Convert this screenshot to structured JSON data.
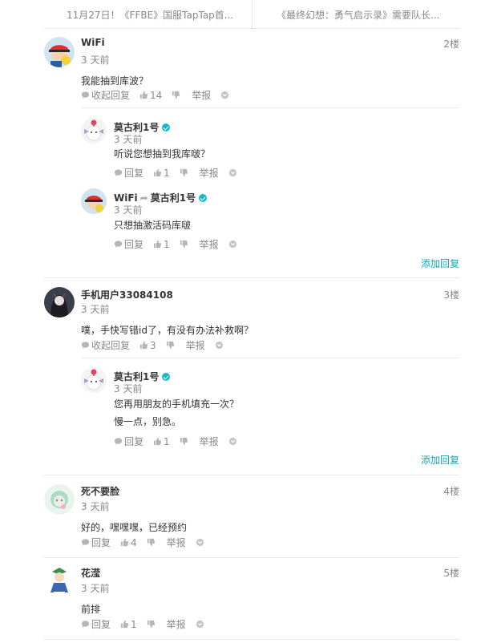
{
  "nav": {
    "prev": "11月27日！《FFBE》国服TapTap首...",
    "next": "《最终幻想：勇气启示录》需要队长..."
  },
  "labels": {
    "collapse_reply": "收起回复",
    "reply": "回复",
    "report": "举报",
    "add_reply": "添加回复"
  },
  "comments": [
    {
      "user": "WiFi",
      "time": "3 天前",
      "floor": "2楼",
      "text": "我能抽到库波？",
      "likes": "14",
      "replies": [
        {
          "user": "莫古利1号",
          "time": "3 天前",
          "text": "听说您想抽到我库啵？",
          "likes": "1"
        },
        {
          "user": "WiFi",
          "to": "莫古利1号",
          "time": "3 天前",
          "text": "只想抽激活码库啵",
          "likes": "1"
        }
      ]
    },
    {
      "user": "手机用户33084108",
      "time": "3 天前",
      "floor": "3楼",
      "text": "噗，手快写错id了，有没有办法补救啊？",
      "likes": "3",
      "replies": [
        {
          "user": "莫古利1号",
          "time": "3 天前",
          "text": "您再用朋友的手机填充一次？",
          "text2": "慢一点，别急。",
          "likes": "1"
        }
      ]
    },
    {
      "user": "死不要脸",
      "time": "3 天前",
      "floor": "4楼",
      "text": "好的，嘿嘿嘿，已经预约",
      "likes": "4"
    },
    {
      "user": "花滢",
      "time": "3 天前",
      "floor": "5楼",
      "text": "前排",
      "likes": "1"
    }
  ],
  "colors": {
    "accent": "#14a8b8",
    "verified": "#14b9c8",
    "muted": "#888888"
  },
  "icons": [
    "comment-icon",
    "thumb-up-icon",
    "thumb-down-icon",
    "chevron-down-icon",
    "verified-icon",
    "reply-arrow-icon"
  ]
}
